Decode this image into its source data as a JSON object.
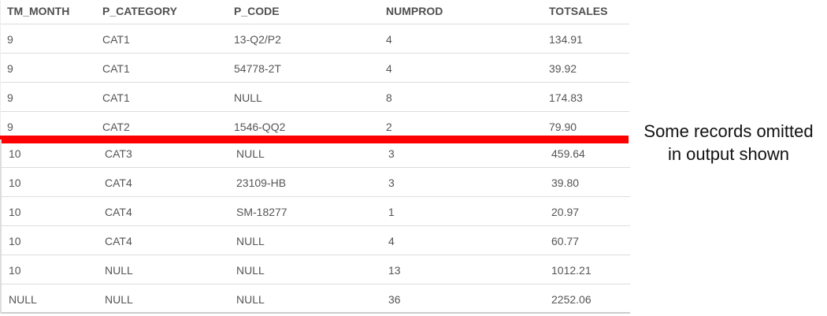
{
  "table": {
    "columns": [
      "TM_MONTH",
      "P_CATEGORY",
      "P_CODE",
      "NUMPROD",
      "TOTSALES"
    ],
    "rows_before_cut": [
      [
        "9",
        "CAT1",
        "13-Q2/P2",
        "4",
        "134.91"
      ],
      [
        "9",
        "CAT1",
        "54778-2T",
        "4",
        "39.92"
      ],
      [
        "9",
        "CAT1",
        "NULL",
        "8",
        "174.83"
      ],
      [
        "9",
        "CAT2",
        "1546-QQ2",
        "2",
        "79.90"
      ]
    ],
    "rows_after_cut": [
      [
        "10",
        "CAT3",
        "NULL",
        "3",
        "459.64"
      ],
      [
        "10",
        "CAT4",
        "23109-HB",
        "3",
        "39.80"
      ],
      [
        "10",
        "CAT4",
        "SM-18277",
        "1",
        "20.97"
      ],
      [
        "10",
        "CAT4",
        "NULL",
        "4",
        "60.77"
      ],
      [
        "10",
        "NULL",
        "NULL",
        "13",
        "1012.21"
      ],
      [
        "NULL",
        "NULL",
        "NULL",
        "36",
        "2252.06"
      ]
    ]
  },
  "annotation": {
    "line1": "Some records omitted",
    "line2": "in output shown",
    "cut_color": "#ff0000"
  }
}
